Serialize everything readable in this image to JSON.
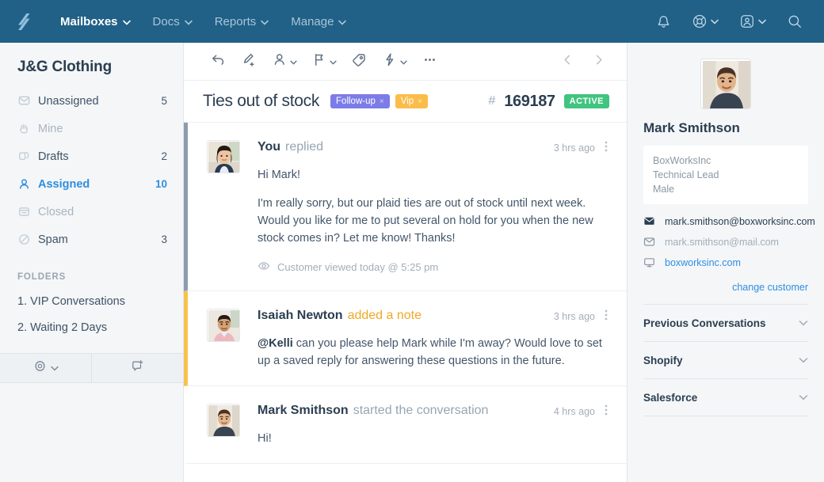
{
  "header": {
    "logo_name": "helpscout-logo",
    "nav": [
      {
        "label": "Mailboxes",
        "active": true,
        "has_chevron": true
      },
      {
        "label": "Docs",
        "active": false,
        "has_chevron": true
      },
      {
        "label": "Reports",
        "active": false,
        "has_chevron": true
      },
      {
        "label": "Manage",
        "active": false,
        "has_chevron": true
      }
    ],
    "actions": [
      {
        "icon": "bell-icon",
        "has_chevron": false
      },
      {
        "icon": "lifebuoy-icon",
        "has_chevron": true
      },
      {
        "icon": "user-circle-icon",
        "has_chevron": true
      },
      {
        "icon": "search-icon",
        "has_chevron": false
      }
    ],
    "background": "#216087"
  },
  "sidebar": {
    "mailbox_title": "J&G Clothing",
    "items": [
      {
        "label": "Unassigned",
        "count": "5",
        "icon": "envelope-icon",
        "state": "normal"
      },
      {
        "label": "Mine",
        "count": "",
        "icon": "hand-icon",
        "state": "dim"
      },
      {
        "label": "Drafts",
        "count": "2",
        "icon": "layers-icon",
        "state": "normal"
      },
      {
        "label": "Assigned",
        "count": "10",
        "icon": "person-icon",
        "state": "selected"
      },
      {
        "label": "Closed",
        "count": "",
        "icon": "archive-icon",
        "state": "dim"
      },
      {
        "label": "Spam",
        "count": "3",
        "icon": "circle-slash-icon",
        "state": "normal"
      }
    ],
    "folders_heading": "FOLDERS",
    "folders": [
      {
        "label": "1. VIP Conversations"
      },
      {
        "label": "2. Waiting 2 Days"
      }
    ],
    "bottom_actions": [
      {
        "icon": "gear-icon",
        "has_chevron": true
      },
      {
        "icon": "new-conversation-icon",
        "has_chevron": false
      }
    ],
    "selected_color": "#2f8ee0"
  },
  "conversation": {
    "toolbar": [
      {
        "icon": "reply-icon",
        "has_chevron": false
      },
      {
        "icon": "add-note-icon",
        "has_chevron": false
      },
      {
        "icon": "assign-icon",
        "has_chevron": true
      },
      {
        "icon": "flag-status-icon",
        "has_chevron": true
      },
      {
        "icon": "tag-icon",
        "has_chevron": false
      },
      {
        "icon": "workflow-icon",
        "has_chevron": true
      },
      {
        "icon": "more-icon",
        "has_chevron": false
      }
    ],
    "prev_label": "previous-conversation",
    "next_label": "next-conversation",
    "title": "Ties out of stock",
    "tags": [
      {
        "label": "Follow-up",
        "remove": "×",
        "color": "#7c7ce8"
      },
      {
        "label": "Vip",
        "remove": "×",
        "color": "#fbbd4a"
      }
    ],
    "hash": "#",
    "ticket_number": "169187",
    "status": "ACTIVE",
    "status_color": "#41c47f",
    "messages": [
      {
        "author": "You",
        "action": "replied",
        "time": "3 hrs ago",
        "type": "reply",
        "avatar": "avatar-agent-kelli",
        "paragraphs": [
          "Hi Mark!",
          "I'm really sorry, but our plaid ties are out of stock until next week. Would you like for me to put several on hold for you when the new stock comes in? Let me know! Thanks!"
        ],
        "receipt": "Customer viewed today @ 5:25 pm",
        "receipt_icon": "eye-icon"
      },
      {
        "author": "Isaiah Newton",
        "action": "added a note",
        "time": "3 hrs ago",
        "type": "note",
        "avatar": "avatar-isaiah-newton",
        "mention": "@Kelli",
        "note_text": " can you please help Mark while I'm away? Would love to set up a saved reply for answering these questions in the future."
      },
      {
        "author": "Mark Smithson",
        "action": "started the conversation",
        "time": "4 hrs ago",
        "type": "start",
        "avatar": "avatar-mark-smithson",
        "paragraphs": [
          "Hi!"
        ]
      }
    ]
  },
  "customer": {
    "avatar": "customer-avatar-mark-smithson",
    "name": "Mark Smithson",
    "details": [
      "BoxWorksInc",
      "Technical Lead",
      "Male"
    ],
    "contacts": [
      {
        "value": "mark.smithson@boxworksinc.com",
        "icon": "envelope-filled-icon",
        "style": "primary"
      },
      {
        "value": "mark.smithson@mail.com",
        "icon": "envelope-icon",
        "style": "muted"
      },
      {
        "value": "boxworksinc.com",
        "icon": "monitor-icon",
        "style": "link"
      }
    ],
    "change_customer": "change customer",
    "sections": [
      {
        "label": "Previous Conversations"
      },
      {
        "label": "Shopify"
      },
      {
        "label": "Salesforce"
      }
    ]
  }
}
